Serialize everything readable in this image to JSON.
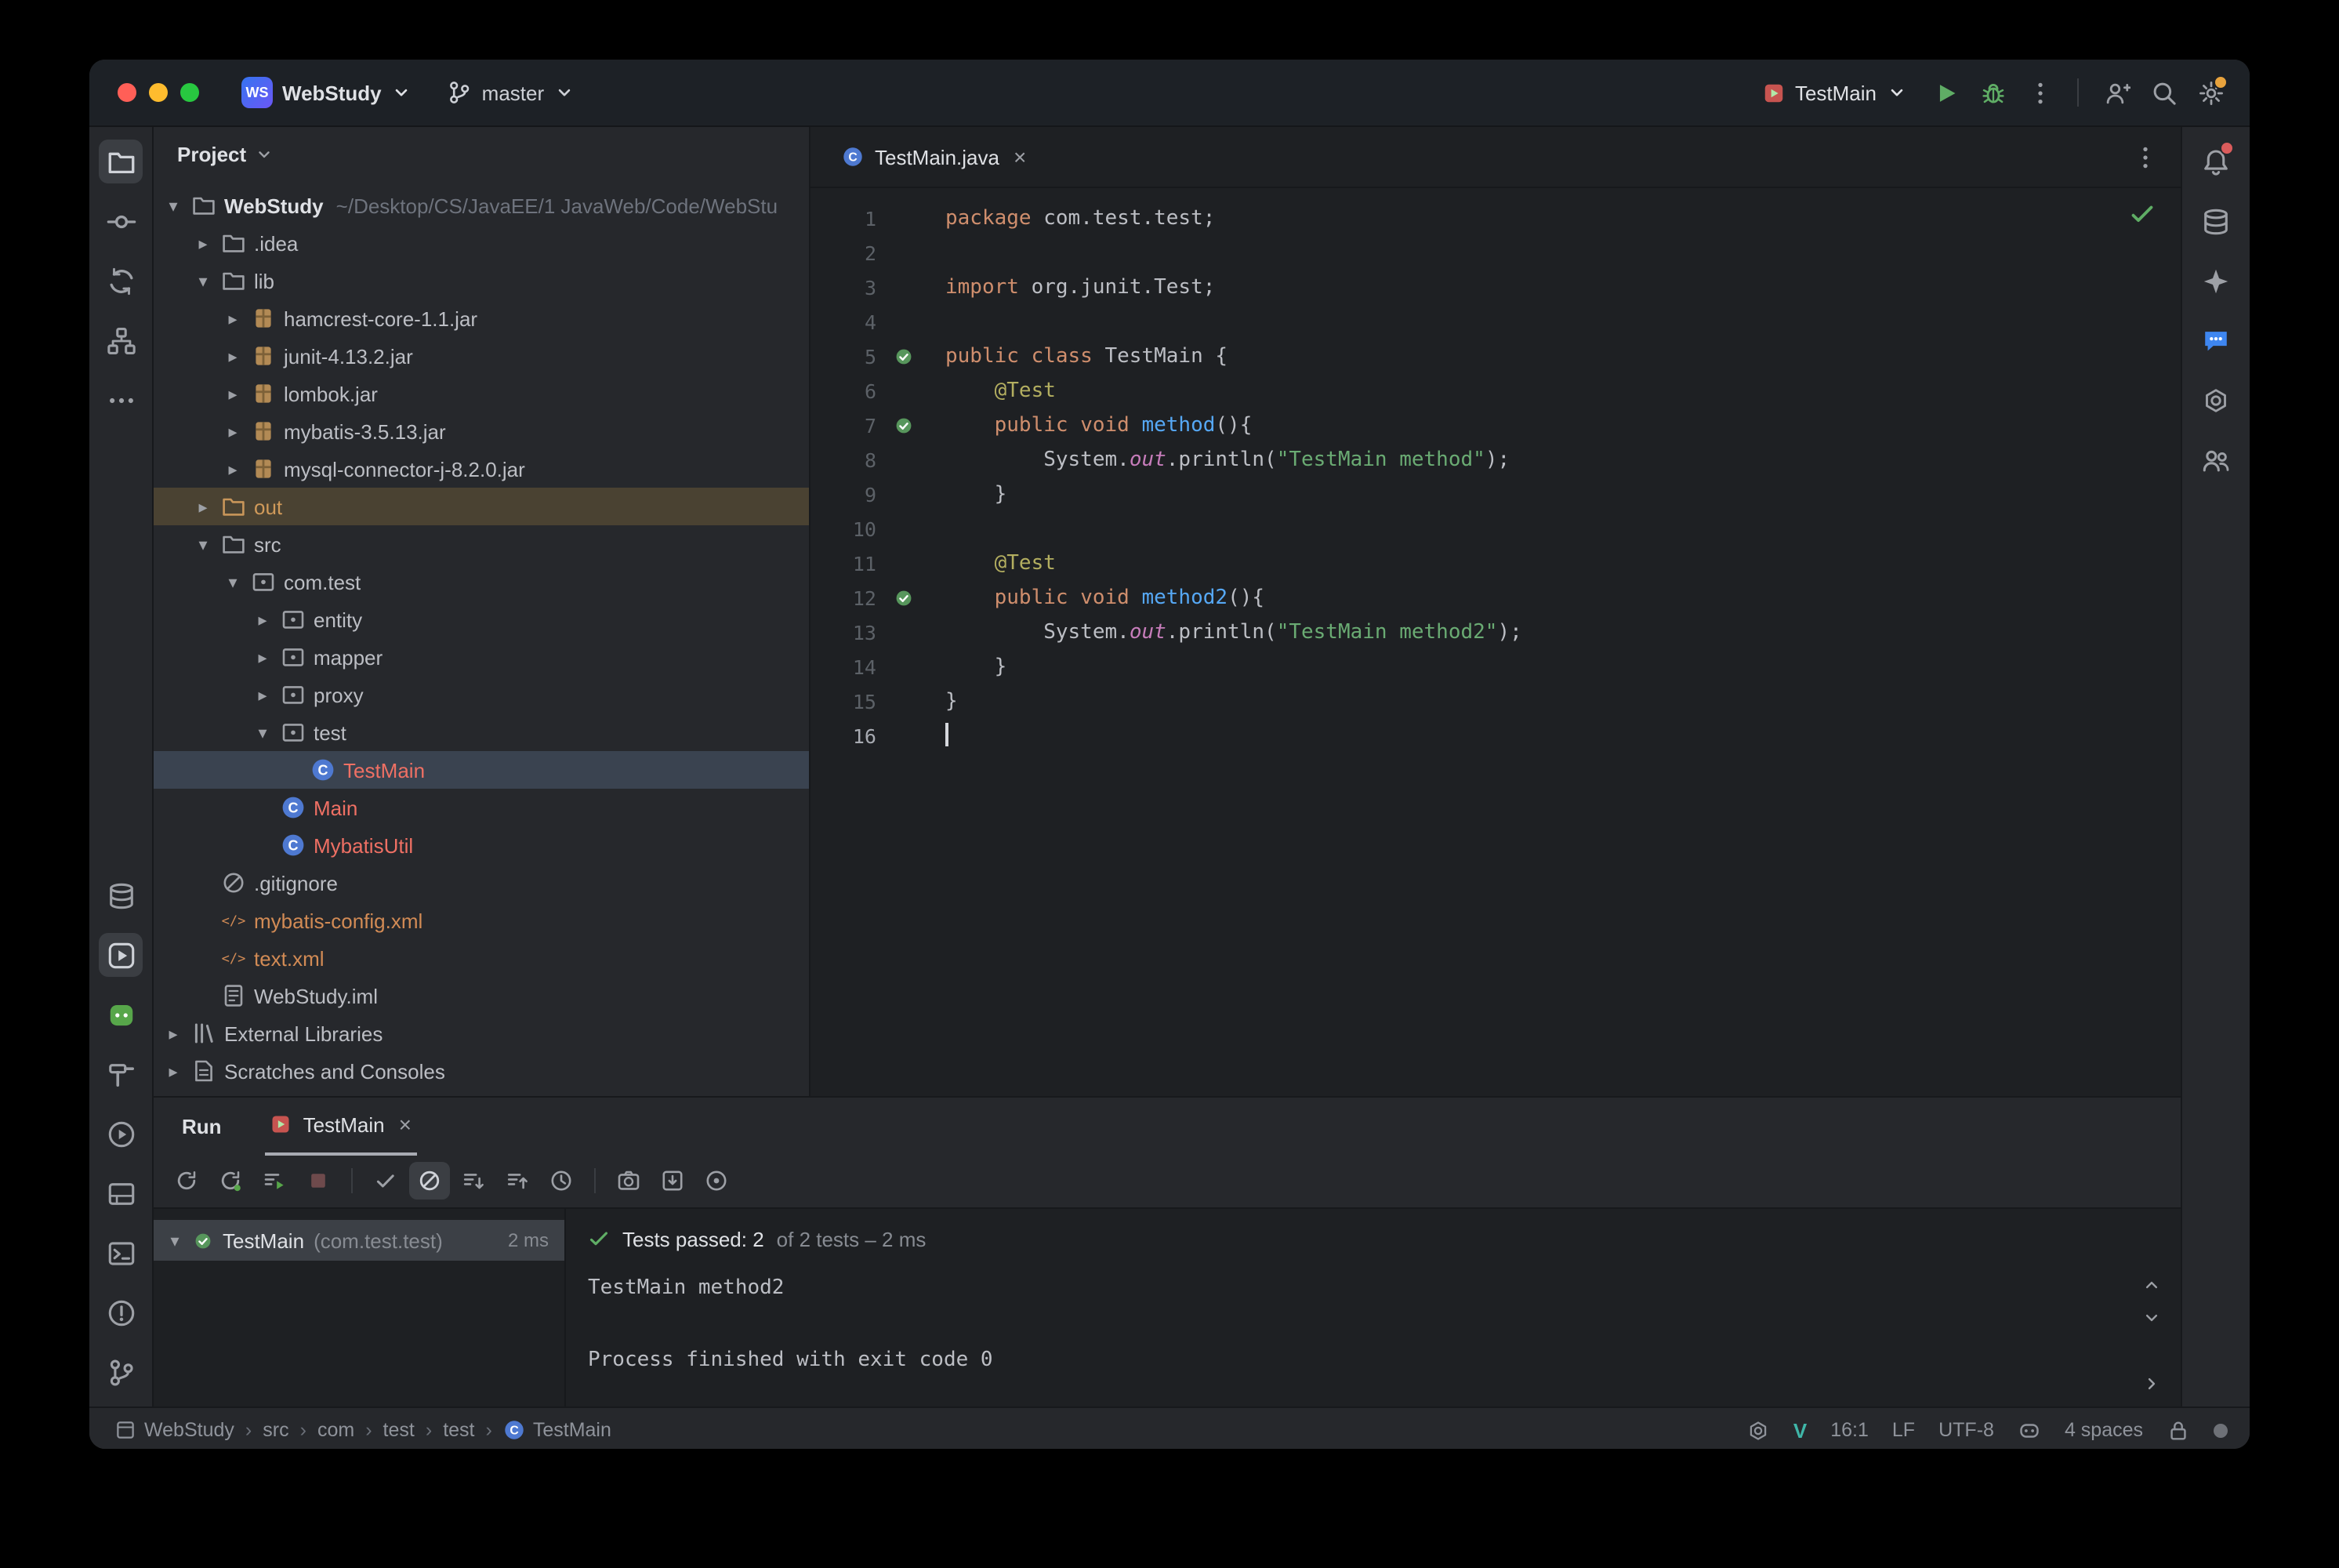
{
  "colors": {
    "accent": "#3574F0",
    "run_green": "#5FAD65",
    "test_pass_green": "#57965C",
    "unversioned_red": "#EF7064",
    "xml_orange": "#D28B55",
    "out_row": "#4A4232",
    "settings_badge": "#E8A33D",
    "notification_badge": "#DB5C5C"
  },
  "titlebar": {
    "logo": "WS",
    "project": "WebStudy",
    "branch": "master",
    "run_config": "TestMain",
    "icons": [
      "chevron-down",
      "branch",
      "junit-config",
      "run-play",
      "debug-bug",
      "more-vertical",
      "add-user",
      "search",
      "settings-gear"
    ]
  },
  "left_strip_top": [
    {
      "name": "project-folder",
      "active": true
    },
    {
      "name": "commit"
    },
    {
      "name": "pull-requests"
    },
    {
      "name": "structure"
    },
    {
      "name": "more-h"
    }
  ],
  "left_strip_bottom": [
    {
      "name": "build-layers"
    },
    {
      "name": "run-play-box",
      "active": true
    },
    {
      "name": "green-mascot"
    },
    {
      "name": "hammer"
    },
    {
      "name": "services"
    },
    {
      "name": "window-panel"
    },
    {
      "name": "terminal"
    },
    {
      "name": "problems"
    },
    {
      "name": "git-branch"
    }
  ],
  "right_strip": [
    {
      "name": "notifications",
      "badge": true
    },
    {
      "name": "database"
    },
    {
      "name": "assistant-star"
    },
    {
      "name": "chat-bubble"
    },
    {
      "name": "openai"
    },
    {
      "name": "users"
    }
  ],
  "project_panel": {
    "header": "Project",
    "tree": [
      {
        "label": "WebStudy",
        "sub": "~/Desktop/CS/JavaEE/1 JavaWeb/Code/WebStu",
        "level": 0,
        "icon": "folder",
        "chev": "open",
        "cls": "bold"
      },
      {
        "label": ".idea",
        "level": 1,
        "icon": "folder",
        "chev": "closed",
        "cls": ""
      },
      {
        "label": "lib",
        "level": 1,
        "icon": "folder",
        "chev": "open",
        "cls": ""
      },
      {
        "label": "hamcrest-core-1.1.jar",
        "level": 2,
        "icon": "jar",
        "chev": "closed",
        "cls": ""
      },
      {
        "label": "junit-4.13.2.jar",
        "level": 2,
        "icon": "jar",
        "chev": "closed",
        "cls": ""
      },
      {
        "label": "lombok.jar",
        "level": 2,
        "icon": "jar",
        "chev": "closed",
        "cls": ""
      },
      {
        "label": "mybatis-3.5.13.jar",
        "level": 2,
        "icon": "jar",
        "chev": "closed",
        "cls": ""
      },
      {
        "label": "mysql-connector-j-8.2.0.jar",
        "level": 2,
        "icon": "jar",
        "chev": "closed",
        "cls": ""
      },
      {
        "label": "out",
        "level": 1,
        "icon": "folder",
        "chev": "closed",
        "cls": "out",
        "row": "outrow"
      },
      {
        "label": "src",
        "level": 1,
        "icon": "folder",
        "chev": "open",
        "cls": ""
      },
      {
        "label": "com.test",
        "level": 2,
        "icon": "package",
        "chev": "open",
        "cls": ""
      },
      {
        "label": "entity",
        "level": 3,
        "icon": "package",
        "chev": "closed",
        "cls": ""
      },
      {
        "label": "mapper",
        "level": 3,
        "icon": "package",
        "chev": "closed",
        "cls": ""
      },
      {
        "label": "proxy",
        "level": 3,
        "icon": "package",
        "chev": "closed",
        "cls": ""
      },
      {
        "label": "test",
        "level": 3,
        "icon": "package",
        "chev": "open",
        "cls": ""
      },
      {
        "label": "TestMain",
        "level": 4,
        "icon": "class",
        "chev": "none",
        "cls": "red",
        "row": "selected"
      },
      {
        "label": "Main",
        "level": 3,
        "icon": "class",
        "chev": "none",
        "cls": "red"
      },
      {
        "label": "MybatisUtil",
        "level": 3,
        "icon": "class",
        "chev": "none",
        "cls": "red"
      },
      {
        "label": ".gitignore",
        "level": 1,
        "icon": "noentry",
        "chev": "none",
        "cls": ""
      },
      {
        "label": "mybatis-config.xml",
        "level": 1,
        "icon": "xml",
        "chev": "none",
        "cls": "orange"
      },
      {
        "label": "text.xml",
        "level": 1,
        "icon": "xml",
        "chev": "none",
        "cls": "orange"
      },
      {
        "label": "WebStudy.iml",
        "level": 1,
        "icon": "module",
        "chev": "none",
        "cls": ""
      },
      {
        "label": "External Libraries",
        "level": 0,
        "icon": "library",
        "chev": "closed",
        "cls": ""
      },
      {
        "label": "Scratches and Consoles",
        "level": 0,
        "icon": "scratch",
        "chev": "closed",
        "cls": ""
      }
    ]
  },
  "editor": {
    "tab_label": "TestMain.java",
    "close_glyph": "×",
    "lines": [
      {
        "n": 1,
        "segs": [
          [
            "k",
            "package "
          ],
          [
            "p",
            "com.test.test;"
          ]
        ]
      },
      {
        "n": 2,
        "segs": []
      },
      {
        "n": 3,
        "segs": [
          [
            "k",
            "import "
          ],
          [
            "p",
            "org.junit.Test;"
          ]
        ]
      },
      {
        "n": 4,
        "segs": []
      },
      {
        "n": 5,
        "g": "pass",
        "segs": [
          [
            "k",
            "public class "
          ],
          [
            "p",
            "TestMain {"
          ]
        ]
      },
      {
        "n": 6,
        "segs": [
          [
            "p",
            "    "
          ],
          [
            "a",
            "@Test"
          ]
        ]
      },
      {
        "n": 7,
        "g": "pass",
        "segs": [
          [
            "p",
            "    "
          ],
          [
            "k",
            "public void "
          ],
          [
            "m",
            "method"
          ],
          [
            "p",
            "(){"
          ]
        ]
      },
      {
        "n": 8,
        "segs": [
          [
            "p",
            "        System."
          ],
          [
            "f",
            "out"
          ],
          [
            "p",
            ".println("
          ],
          [
            "s",
            "\"TestMain method\""
          ],
          [
            "p",
            ");"
          ]
        ]
      },
      {
        "n": 9,
        "segs": [
          [
            "p",
            "    }"
          ]
        ]
      },
      {
        "n": 10,
        "segs": []
      },
      {
        "n": 11,
        "segs": [
          [
            "p",
            "    "
          ],
          [
            "a",
            "@Test"
          ]
        ]
      },
      {
        "n": 12,
        "g": "pass",
        "segs": [
          [
            "p",
            "    "
          ],
          [
            "k",
            "public void "
          ],
          [
            "m",
            "method2"
          ],
          [
            "p",
            "(){"
          ]
        ]
      },
      {
        "n": 13,
        "segs": [
          [
            "p",
            "        System."
          ],
          [
            "f",
            "out"
          ],
          [
            "p",
            ".println("
          ],
          [
            "s",
            "\"TestMain method2\""
          ],
          [
            "p",
            ");"
          ]
        ]
      },
      {
        "n": 14,
        "segs": [
          [
            "p",
            "    }"
          ]
        ]
      },
      {
        "n": 15,
        "segs": [
          [
            "p",
            "}"
          ]
        ]
      },
      {
        "n": 16,
        "segs": [],
        "caret": true,
        "current": true
      }
    ]
  },
  "run_panel": {
    "label": "Run",
    "tab": "TestMain",
    "close_glyph": "×",
    "toolbar": [
      {
        "name": "rerun"
      },
      {
        "name": "rerun-failed"
      },
      {
        "name": "auto-test"
      },
      {
        "name": "stop"
      },
      {
        "name": "divider"
      },
      {
        "name": "show-passed"
      },
      {
        "name": "show-ignored",
        "active": true
      },
      {
        "name": "sort-down"
      },
      {
        "name": "sort-up"
      },
      {
        "name": "duration"
      },
      {
        "name": "divider"
      },
      {
        "name": "test-history"
      },
      {
        "name": "import-tests"
      },
      {
        "name": "navigate"
      },
      {
        "name": "more-vertical"
      }
    ],
    "test_row": {
      "name": "TestMain",
      "pkg": "(com.test.test)",
      "time": "2 ms"
    },
    "status_strong": "Tests passed: 2",
    "status_dim": "of 2 tests – 2 ms",
    "console": [
      "TestMain method2",
      "",
      "Process finished with exit code 0"
    ]
  },
  "statusbar": {
    "crumbs": [
      "WebStudy",
      "src",
      "com",
      "test",
      "test",
      "TestMain"
    ],
    "v_glyph": "V",
    "caret_pos": "16:1",
    "line_separator": "LF",
    "encoding": "UTF-8",
    "indent": "4 spaces"
  }
}
